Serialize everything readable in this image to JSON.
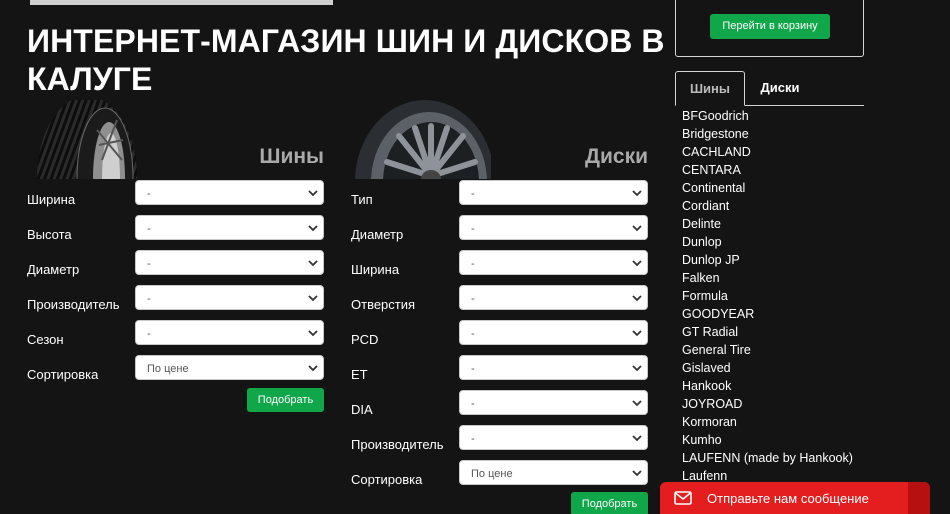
{
  "page": {
    "title": "ИНТЕРНЕТ-МАГАЗИН ШИН И ДИСКОВ В КАЛУГЕ"
  },
  "cart": {
    "button_label": "Перейти в корзину"
  },
  "tyres_form": {
    "title": "Шины",
    "fields": [
      {
        "label": "Ширина",
        "value": "-"
      },
      {
        "label": "Высота",
        "value": "-"
      },
      {
        "label": "Диаметр",
        "value": "-"
      },
      {
        "label": "Производитель",
        "value": "-"
      },
      {
        "label": "Сезон",
        "value": "-"
      },
      {
        "label": "Сортировка",
        "value": "По цене"
      }
    ],
    "submit_label": "Подобрать"
  },
  "wheels_form": {
    "title": "Диски",
    "fields": [
      {
        "label": "Тип",
        "value": "-"
      },
      {
        "label": "Диаметр",
        "value": "-"
      },
      {
        "label": "Ширина",
        "value": "-"
      },
      {
        "label": "Отверстия",
        "value": "-"
      },
      {
        "label": "PCD",
        "value": "-"
      },
      {
        "label": "ET",
        "value": "-"
      },
      {
        "label": "DIA",
        "value": "-"
      },
      {
        "label": "Производитель",
        "value": "-"
      },
      {
        "label": "Сортировка",
        "value": "По цене"
      }
    ],
    "submit_label": "Подобрать"
  },
  "brand_tabs": {
    "tyres": "Шины",
    "wheels": "Диски",
    "active": "tyres"
  },
  "brands": [
    "BFGoodrich",
    "Bridgestone",
    "CACHLAND",
    "CENTARA",
    "Continental",
    "Cordiant",
    "Delinte",
    "Dunlop",
    "Dunlop JP",
    "Falken",
    "Formula",
    "GOODYEAR",
    "GT Radial",
    "General Tire",
    "Gislaved",
    "Hankook",
    "JOYROAD",
    "Kormoran",
    "Kumho",
    "LAUFENN (made by Hankook)",
    "Laufenn"
  ],
  "chat": {
    "label": "Отправьте нам сообщение"
  },
  "colors": {
    "background": "#141414",
    "accent_green": "#10a64a",
    "chat_red": "#e41e1e",
    "form_title_gray": "#a9a9a9"
  },
  "icons": {
    "select_arrow": "chevron-down-icon",
    "chat": "mail-icon"
  }
}
